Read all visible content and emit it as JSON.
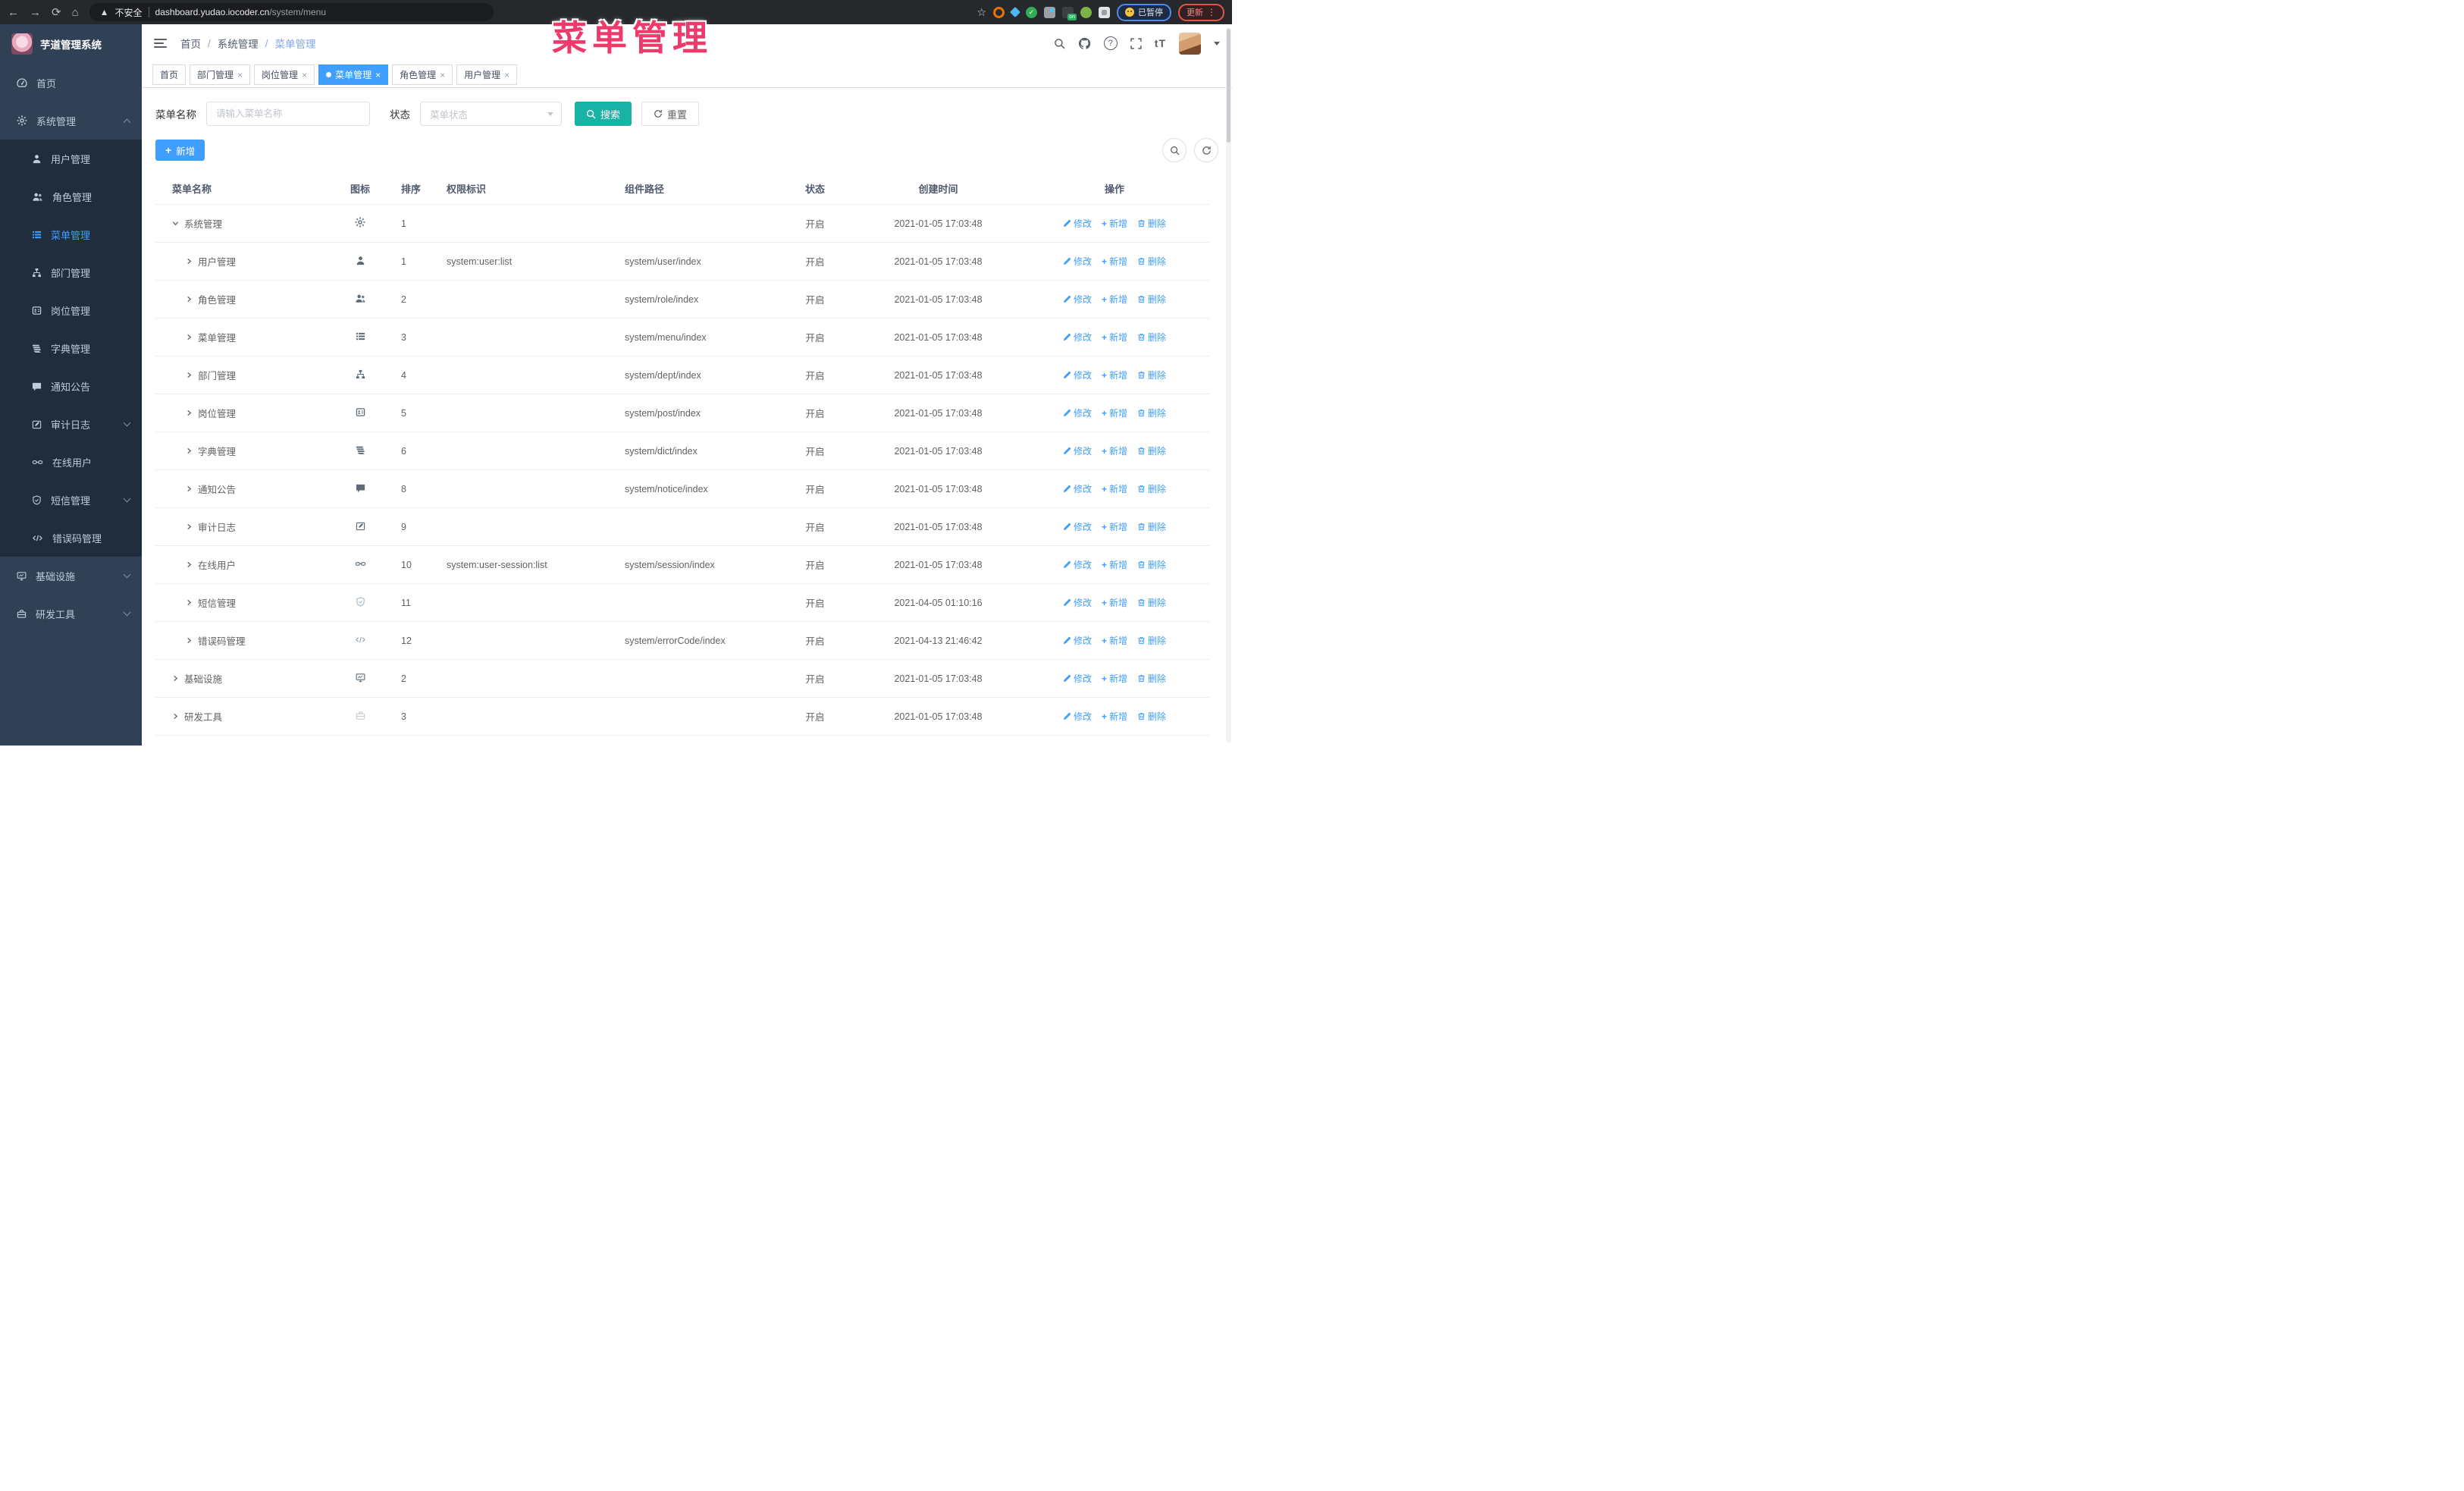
{
  "overlay_title": "菜单管理",
  "colors": {
    "accent": "#409EFF",
    "search_button": "#18B3A4",
    "sidebar_bg": "#304156",
    "submenu_bg": "#1F2D3D",
    "overlay_pink": "#EE3A6A",
    "active_tab_bg": "#409EFF"
  },
  "browser": {
    "security_text": "不安全",
    "url_host": "dashboard.yudao.iocoder.cn",
    "url_path": "/system/menu",
    "paused_label": "已暂停",
    "update_label": "更新",
    "extensions": [
      {
        "key": "orange-ring"
      },
      {
        "key": "blue-gem"
      },
      {
        "key": "green-check",
        "glyph": "✓"
      },
      {
        "key": "grid"
      },
      {
        "key": "server",
        "badge": "on"
      },
      {
        "key": "green-key"
      },
      {
        "key": "puzzle"
      }
    ]
  },
  "sidebar": {
    "title": "芋道管理系统",
    "items": [
      {
        "key": "home",
        "label": "首页",
        "icon": "dashboard",
        "type": "top"
      },
      {
        "key": "system",
        "label": "系统管理",
        "icon": "gear",
        "type": "top",
        "arrow": "up"
      },
      {
        "key": "user",
        "label": "用户管理",
        "icon": "user",
        "type": "sub"
      },
      {
        "key": "role",
        "label": "角色管理",
        "icon": "users",
        "type": "sub"
      },
      {
        "key": "menu",
        "label": "菜单管理",
        "icon": "list",
        "type": "sub",
        "active": true
      },
      {
        "key": "dept",
        "label": "部门管理",
        "icon": "tree",
        "type": "sub"
      },
      {
        "key": "post",
        "label": "岗位管理",
        "icon": "badge",
        "type": "sub"
      },
      {
        "key": "dict",
        "label": "字典管理",
        "icon": "book",
        "type": "sub"
      },
      {
        "key": "notice",
        "label": "通知公告",
        "icon": "message",
        "type": "sub"
      },
      {
        "key": "audit-log",
        "label": "审计日志",
        "icon": "edit",
        "type": "sub",
        "arrow": "down"
      },
      {
        "key": "online-user",
        "label": "在线用户",
        "icon": "link",
        "type": "sub"
      },
      {
        "key": "sms",
        "label": "短信管理",
        "icon": "shield",
        "type": "sub",
        "arrow": "down"
      },
      {
        "key": "error-code",
        "label": "错误码管理",
        "icon": "code",
        "type": "sub"
      },
      {
        "key": "infra",
        "label": "基础设施",
        "icon": "monitor",
        "type": "top",
        "arrow": "down"
      },
      {
        "key": "dev-tools",
        "label": "研发工具",
        "icon": "toolbox",
        "type": "top",
        "arrow": "down"
      }
    ]
  },
  "navbar": {
    "breadcrumb": [
      "首页",
      "系统管理",
      "菜单管理"
    ],
    "question_mark": "?",
    "font_size_label": "tT"
  },
  "tabs": [
    {
      "key": "home",
      "label": "首页",
      "closable": false,
      "active": false
    },
    {
      "key": "dept",
      "label": "部门管理",
      "closable": true,
      "active": false
    },
    {
      "key": "post",
      "label": "岗位管理",
      "closable": true,
      "active": false
    },
    {
      "key": "menu",
      "label": "菜单管理",
      "closable": true,
      "active": true
    },
    {
      "key": "role",
      "label": "角色管理",
      "closable": true,
      "active": false
    },
    {
      "key": "user",
      "label": "用户管理",
      "closable": true,
      "active": false
    }
  ],
  "filters": {
    "name_label": "菜单名称",
    "name_placeholder": "请输入菜单名称",
    "name_value": "",
    "status_label": "状态",
    "status_placeholder": "菜单状态",
    "search_label": "搜索",
    "reset_label": "重置"
  },
  "toolbar": {
    "add_label": "新增"
  },
  "table": {
    "columns": [
      "菜单名称",
      "图标",
      "排序",
      "权限标识",
      "组件路径",
      "状态",
      "创建时间",
      "操作"
    ],
    "op_labels": {
      "edit": "修改",
      "add": "新增",
      "delete": "删除"
    },
    "rows": [
      {
        "key": "system",
        "name": "系统管理",
        "icon": "gear",
        "level": 0,
        "expand": "down",
        "sort": "1",
        "perm": "",
        "path": "",
        "status": "开启",
        "time": "2021-01-05 17:03:48"
      },
      {
        "key": "user",
        "name": "用户管理",
        "icon": "user",
        "level": 1,
        "expand": "right",
        "sort": "1",
        "perm": "system:user:list",
        "path": "system/user/index",
        "status": "开启",
        "time": "2021-01-05 17:03:48"
      },
      {
        "key": "role",
        "name": "角色管理",
        "icon": "users",
        "level": 1,
        "expand": "right",
        "sort": "2",
        "perm": "",
        "path": "system/role/index",
        "status": "开启",
        "time": "2021-01-05 17:03:48"
      },
      {
        "key": "menu",
        "name": "菜单管理",
        "icon": "list",
        "level": 1,
        "expand": "right",
        "sort": "3",
        "perm": "",
        "path": "system/menu/index",
        "status": "开启",
        "time": "2021-01-05 17:03:48"
      },
      {
        "key": "dept",
        "name": "部门管理",
        "icon": "tree",
        "level": 1,
        "expand": "right",
        "sort": "4",
        "perm": "",
        "path": "system/dept/index",
        "status": "开启",
        "time": "2021-01-05 17:03:48"
      },
      {
        "key": "post",
        "name": "岗位管理",
        "icon": "badge",
        "level": 1,
        "expand": "right",
        "sort": "5",
        "perm": "",
        "path": "system/post/index",
        "status": "开启",
        "time": "2021-01-05 17:03:48"
      },
      {
        "key": "dict",
        "name": "字典管理",
        "icon": "book",
        "level": 1,
        "expand": "right",
        "sort": "6",
        "perm": "",
        "path": "system/dict/index",
        "status": "开启",
        "time": "2021-01-05 17:03:48"
      },
      {
        "key": "notice",
        "name": "通知公告",
        "icon": "message",
        "level": 1,
        "expand": "right",
        "sort": "8",
        "perm": "",
        "path": "system/notice/index",
        "status": "开启",
        "time": "2021-01-05 17:03:48"
      },
      {
        "key": "audit-log",
        "name": "审计日志",
        "icon": "edit",
        "level": 1,
        "expand": "right",
        "sort": "9",
        "perm": "",
        "path": "",
        "status": "开启",
        "time": "2021-01-05 17:03:48"
      },
      {
        "key": "online-user",
        "name": "在线用户",
        "icon": "link",
        "level": 1,
        "expand": "right",
        "sort": "10",
        "perm": "system:user-session:list",
        "path": "system/session/index",
        "status": "开启",
        "time": "2021-01-05 17:03:48"
      },
      {
        "key": "sms",
        "name": "短信管理",
        "icon": "shield",
        "level": 1,
        "expand": "right",
        "sort": "11",
        "perm": "",
        "path": "",
        "status": "开启",
        "time": "2021-04-05 01:10:16",
        "icon_color": "#9FBACE"
      },
      {
        "key": "error-code",
        "name": "错误码管理",
        "icon": "code",
        "level": 1,
        "expand": "right",
        "sort": "12",
        "perm": "",
        "path": "system/errorCode/index",
        "status": "开启",
        "time": "2021-04-13 21:46:42",
        "icon_color": "#9AA8B5"
      },
      {
        "key": "infra",
        "name": "基础设施",
        "icon": "monitor",
        "level": 0,
        "expand": "right",
        "sort": "2",
        "perm": "",
        "path": "",
        "status": "开启",
        "time": "2021-01-05 17:03:48"
      },
      {
        "key": "dev-tools",
        "name": "研发工具",
        "icon": "toolbox",
        "level": 0,
        "expand": "right",
        "sort": "3",
        "perm": "",
        "path": "",
        "status": "开启",
        "time": "2021-01-05 17:03:48",
        "icon_color": "#C5CDD4"
      }
    ]
  }
}
